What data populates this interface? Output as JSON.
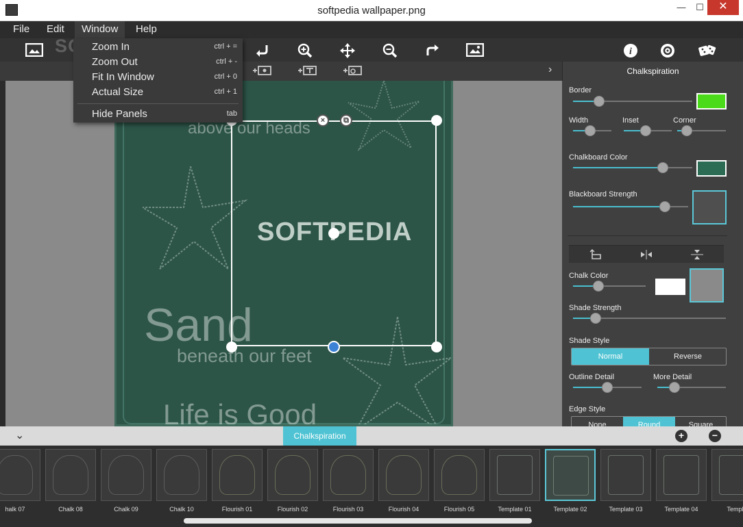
{
  "window": {
    "title": "softpedia wallpaper.png",
    "minimize": "—",
    "maximize": "☐",
    "close": "✕"
  },
  "menu": {
    "items": [
      "File",
      "Edit",
      "Window",
      "Help"
    ],
    "active": "Window"
  },
  "toolbar": {
    "watermark": "SOFTPEDIA",
    "icons": [
      "image-icon",
      "undo-icon",
      "zoom-in-icon",
      "move-icon",
      "zoom-out-icon",
      "redo-icon",
      "picture-icon",
      "info-icon",
      "settings-icon",
      "dice-icon"
    ]
  },
  "window_menu": {
    "items": [
      {
        "label": "Zoom In",
        "shortcut": "ctrl + ="
      },
      {
        "label": "Zoom Out",
        "shortcut": "ctrl + -"
      },
      {
        "label": "Fit In Window",
        "shortcut": "ctrl + 0"
      },
      {
        "label": "Actual Size",
        "shortcut": "ctrl + 1"
      },
      {
        "label": "Hide Panels",
        "shortcut": "tab"
      }
    ]
  },
  "subtoolbar": {
    "add_icons": [
      "add-image-icon",
      "add-text-icon",
      "add-shape-icon"
    ],
    "panel_title": "Chalkspiration"
  },
  "canvas": {
    "text_top": "above our heads",
    "watermark": "SOFTPEDIA",
    "text_big": "Sand",
    "text_sub": "beneath our feet",
    "text_bottom": "Life is Good"
  },
  "panel": {
    "border": {
      "label": "Border",
      "value": 0.22,
      "color": "#4cdb1a"
    },
    "width": {
      "label": "Width",
      "value": 0.45
    },
    "inset": {
      "label": "Inset",
      "value": 0.45
    },
    "corner": {
      "label": "Corner",
      "value": 0.2
    },
    "chalkboard_color": {
      "label": "Chalkboard Color",
      "value": 0.75,
      "color": "#2c6b54"
    },
    "blackboard_strength": {
      "label": "Blackboard Strength",
      "value": 0.8
    },
    "chalk_color": {
      "label": "Chalk Color",
      "value": 0.35,
      "color": "#ffffff"
    },
    "shade_strength": {
      "label": "Shade Strength",
      "value": 0.15
    },
    "shade_style": {
      "label": "Shade Style",
      "options": [
        "Normal",
        "Reverse"
      ],
      "selected": "Normal"
    },
    "outline_detail": {
      "label": "Outline Detail",
      "value": 0.5
    },
    "more_detail": {
      "label": "More Detail",
      "value": 0.25
    },
    "edge_style": {
      "label": "Edge Style",
      "options": [
        "None",
        "Round",
        "Square"
      ],
      "selected": "Round"
    }
  },
  "bottom": {
    "tab": "Chalkspiration",
    "add": "+",
    "remove": "−"
  },
  "presets": [
    {
      "name": "halk 07",
      "kind": "ch"
    },
    {
      "name": "Chalk 08",
      "kind": "ch"
    },
    {
      "name": "Chalk 09",
      "kind": "ch"
    },
    {
      "name": "Chalk 10",
      "kind": "ch"
    },
    {
      "name": "Flourish 01",
      "kind": "fl"
    },
    {
      "name": "Flourish 02",
      "kind": "fl"
    },
    {
      "name": "Flourish 03",
      "kind": "fl"
    },
    {
      "name": "Flourish 04",
      "kind": "fl"
    },
    {
      "name": "Flourish 05",
      "kind": "fl"
    },
    {
      "name": "Template 01",
      "kind": "tp"
    },
    {
      "name": "Template 02",
      "kind": "tp",
      "selected": true
    },
    {
      "name": "Template 03",
      "kind": "tp"
    },
    {
      "name": "Template 04",
      "kind": "tp"
    },
    {
      "name": "Templa",
      "kind": "tp"
    }
  ]
}
